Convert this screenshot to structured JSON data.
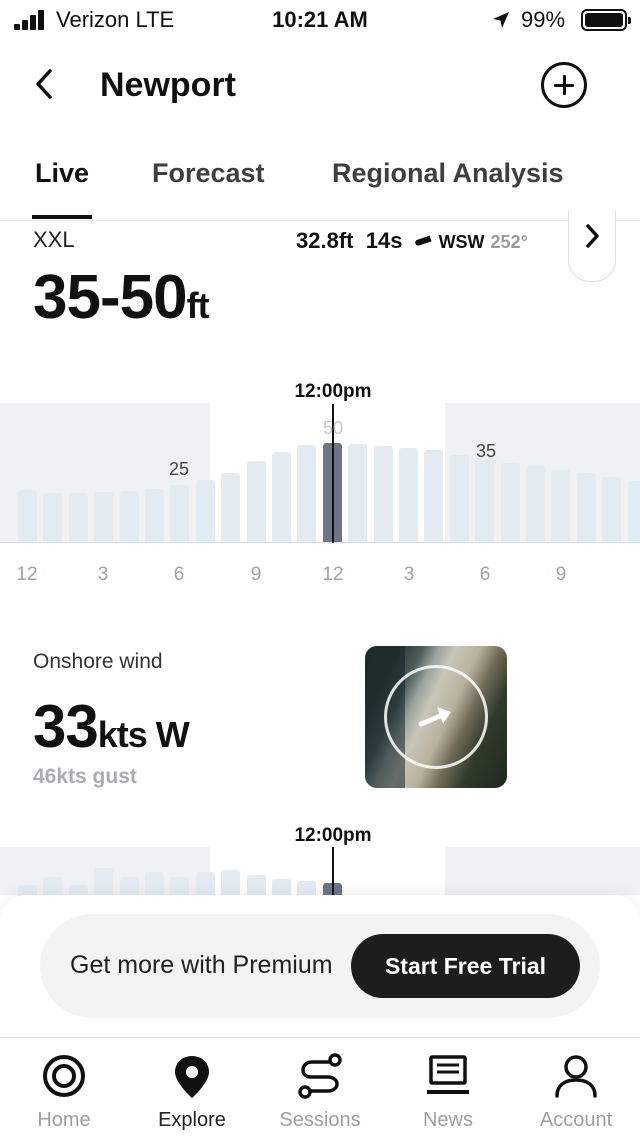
{
  "status_bar": {
    "carrier": "Verizon  LTE",
    "time": "10:21 AM",
    "battery": "99%"
  },
  "header": {
    "title": "Newport",
    "icons": {
      "back": "chevron-left-icon",
      "add": "add-circle-icon"
    }
  },
  "tabs": [
    {
      "label": "Live",
      "active": true
    },
    {
      "label": "Forecast",
      "active": false
    },
    {
      "label": "Regional Analysis",
      "active": false
    }
  ],
  "surf": {
    "rating": "XXL",
    "height_value": "35-50",
    "height_unit": "ft",
    "swell_height": "32.8ft",
    "swell_period": "14s",
    "swell_direction": "WSW",
    "swell_degrees": "252°"
  },
  "surf_chart": {
    "now_label": "12:00pm",
    "value_labels": [
      "25",
      "50",
      "35"
    ],
    "ticks": [
      "12",
      "3",
      "6",
      "9",
      "12",
      "3",
      "6",
      "9"
    ]
  },
  "wind": {
    "label": "Onshore wind",
    "speed_value": "33",
    "speed_unit": "kts W",
    "gust": "46kts gust"
  },
  "wind_chart": {
    "now_label": "12:00pm"
  },
  "promo": {
    "text": "Get more with Premium",
    "button_label": "Start Free Trial"
  },
  "tab_bar": [
    {
      "label": "Home",
      "icon": "home-target-icon",
      "active": false
    },
    {
      "label": "Explore",
      "icon": "map-pin-icon",
      "active": true
    },
    {
      "label": "Sessions",
      "icon": "sessions-route-icon",
      "active": false
    },
    {
      "label": "News",
      "icon": "news-laptop-icon",
      "active": false
    },
    {
      "label": "Account",
      "icon": "account-person-icon",
      "active": false
    }
  ],
  "colors": {
    "accent": "#111111",
    "bar": "#e3ebf2",
    "bar_current": "#6d7686",
    "night_shade": "#f0f1f5"
  }
}
